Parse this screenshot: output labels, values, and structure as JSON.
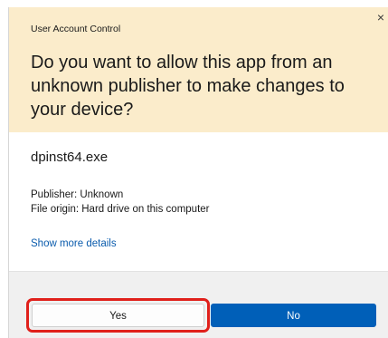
{
  "window": {
    "title": "User Account Control",
    "close_icon": "close-icon",
    "close_glyph": "×"
  },
  "prompt": {
    "question": "Do you want to allow this app from an unknown publisher to make changes to your device?"
  },
  "app": {
    "name": "dpinst64.exe",
    "publisher": "Publisher: Unknown",
    "file_origin": "File origin: Hard drive on this computer",
    "show_more_label": "Show more details"
  },
  "buttons": {
    "yes_label": "Yes",
    "no_label": "No"
  },
  "colors": {
    "header_background": "#fbeccb",
    "primary_button": "#005fb8",
    "link": "#0b5cad",
    "highlight": "#e0201b"
  }
}
